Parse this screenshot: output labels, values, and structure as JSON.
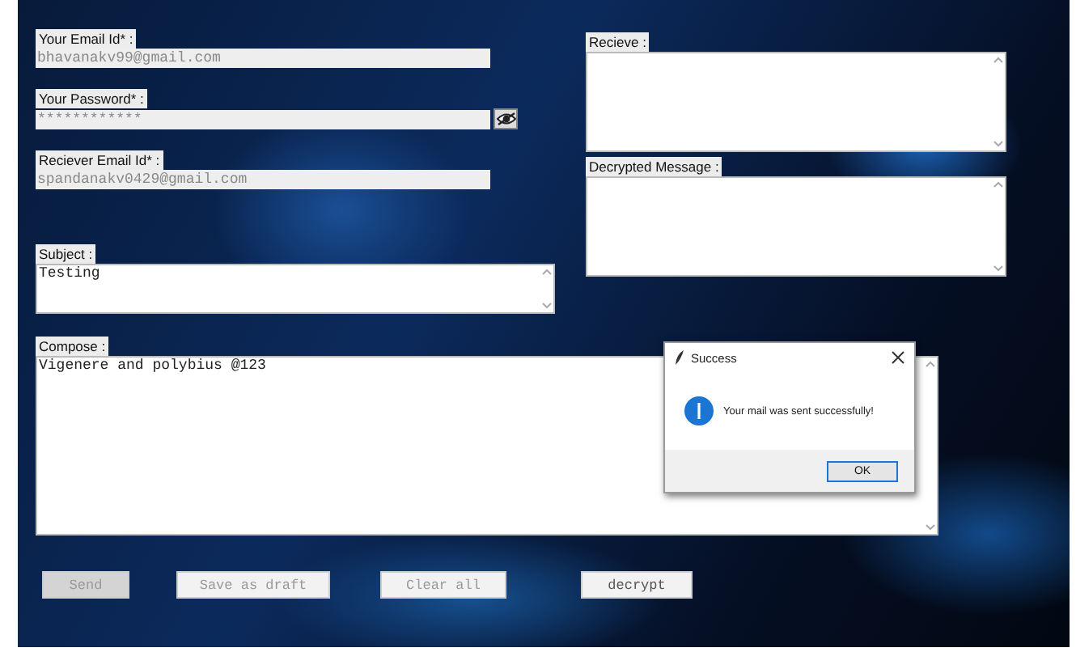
{
  "fields": [
    {
      "label": "Your Email Id* :",
      "value": "bhavanakv99@gmail.com",
      "kind": "text"
    },
    {
      "label": "Your Password* :",
      "value": "************",
      "kind": "password"
    },
    {
      "label": "Reciever Email Id* :",
      "value": "spandanakv0429@gmail.com",
      "kind": "text"
    }
  ],
  "subject": {
    "label": "Subject :",
    "value": "Testing"
  },
  "receive": {
    "label": "Recieve :"
  },
  "decrypted": {
    "label": "Decrypted Message :"
  },
  "compose": {
    "label": "Compose :",
    "value": "Vigenere and polybius @123"
  },
  "buttons": [
    {
      "label": "Send",
      "kind": "dark"
    },
    {
      "label": "Save as draft",
      "kind": "light"
    },
    {
      "label": "Clear all",
      "kind": "light"
    },
    {
      "label": "decrypt",
      "kind": "light"
    }
  ],
  "dialog": {
    "title": "Success",
    "message": "Your mail was sent successfully!",
    "button": "OK"
  }
}
